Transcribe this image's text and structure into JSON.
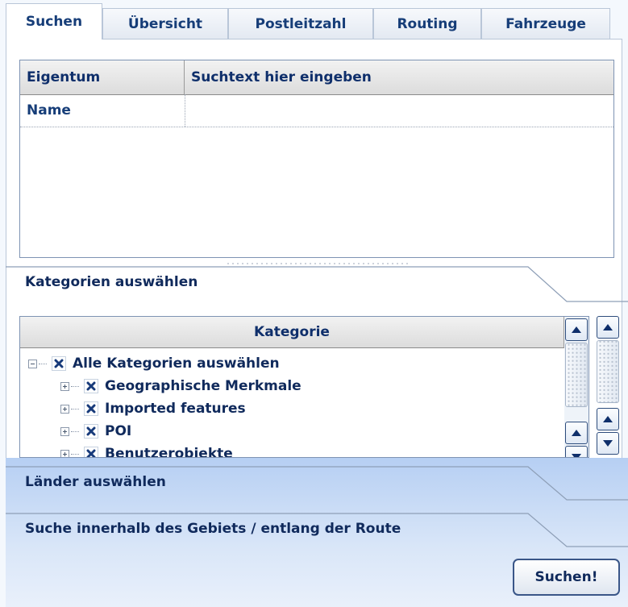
{
  "tabs": [
    {
      "label": "Suchen",
      "active": true
    },
    {
      "label": "Übersicht",
      "active": false
    },
    {
      "label": "Postleitzahl",
      "active": false
    },
    {
      "label": "Routing",
      "active": false
    },
    {
      "label": "Fahrzeuge",
      "active": false
    }
  ],
  "property_grid": {
    "columns": [
      "Eigentum",
      "Suchtext hier eingeben"
    ],
    "rows": [
      {
        "property": "Name",
        "value": ""
      }
    ]
  },
  "categories_section": {
    "title": "Kategorien auswählen",
    "column_header": "Kategorie",
    "items": [
      {
        "label": "Alle Kategorien auswählen",
        "level": 0,
        "expander": "minus",
        "checked": true
      },
      {
        "label": "Geographische Merkmale",
        "level": 1,
        "expander": "plus",
        "checked": true
      },
      {
        "label": "Imported features",
        "level": 1,
        "expander": "plus",
        "checked": true
      },
      {
        "label": "POI",
        "level": 1,
        "expander": "plus",
        "checked": true
      },
      {
        "label": "Benutzerobjekte",
        "level": 1,
        "expander": "plus",
        "checked": true
      }
    ]
  },
  "countries_section": {
    "title": "Länder auswählen"
  },
  "area_section": {
    "title": "Suche innerhalb des Gebiets / entlang der Route"
  },
  "search_button": {
    "label": "Suchen!"
  },
  "colors": {
    "accent": "#163d78",
    "panel_gradient_top": "#b6cff3",
    "check_mark": "#173a7a"
  }
}
